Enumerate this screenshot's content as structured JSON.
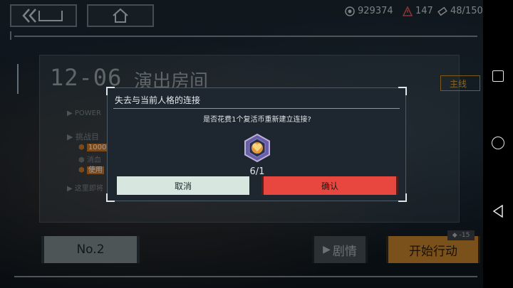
{
  "resources": {
    "currency_a": "929374",
    "currency_b": "147",
    "stamina": "48/150"
  },
  "level": {
    "number": "12-06",
    "name": "演出房间",
    "tag": "主线",
    "power_label": "POWER",
    "challenge_label": "挑战目",
    "objective_1": "1000",
    "objective_2": "消血",
    "objective_3": "使用",
    "note": "这里即将"
  },
  "bottom": {
    "team_label": "No.2",
    "story_label": "剧情",
    "start_label": "开始行动",
    "cost_label": "-15"
  },
  "dialog": {
    "title": "失去与当前人格的连接",
    "message": "是否花费1个复活币重新建立连接?",
    "coin_count": "6/1",
    "cancel_label": "取消",
    "confirm_label": "确认"
  },
  "colors": {
    "accent_orange": "#d9892a",
    "confirm_red": "#e8473f",
    "cancel_bg": "#d7e6df"
  }
}
